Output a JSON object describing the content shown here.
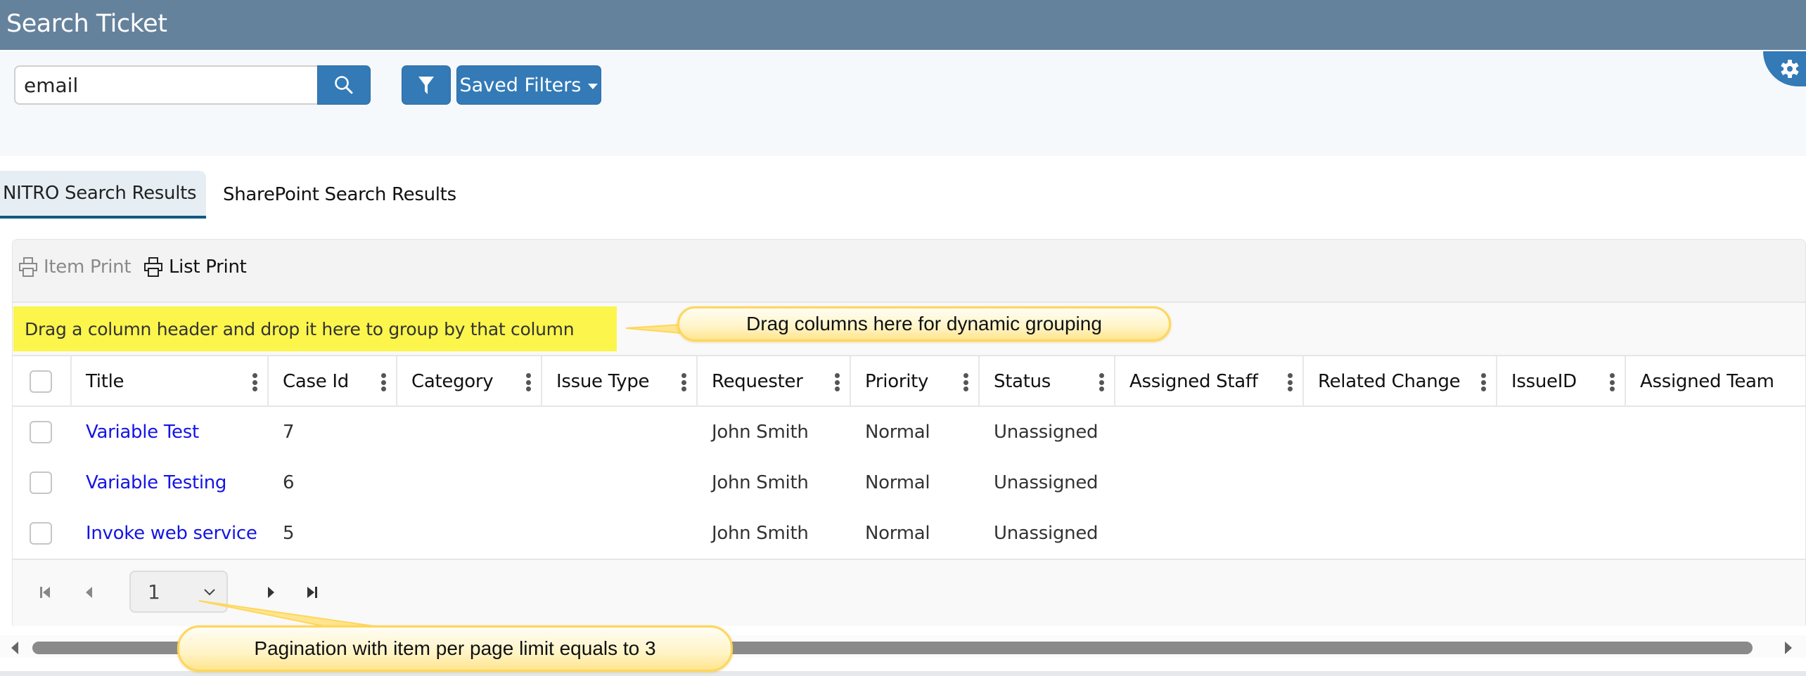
{
  "header": {
    "title": "Search Ticket"
  },
  "search": {
    "value": "email",
    "placeholder": ""
  },
  "toolbar": {
    "saved_filters_label": "Saved Filters"
  },
  "icons": {
    "search": "search-icon",
    "filter": "filter-icon",
    "settings": "gear-icon",
    "print": "printer-icon"
  },
  "tabs": [
    {
      "label": "NITRO Search Results",
      "active": true
    },
    {
      "label": "SharePoint Search Results",
      "active": false
    }
  ],
  "grid": {
    "toolbar": {
      "item_print": "Item Print",
      "list_print": "List Print"
    },
    "group_zone_text": "Drag a column header and drop it here to group by that column",
    "columns": [
      "Title",
      "Case Id",
      "Category",
      "Issue Type",
      "Requester",
      "Priority",
      "Status",
      "Assigned Staff",
      "Related Change",
      "IssueID",
      "Assigned Team"
    ],
    "rows": [
      {
        "title": "Variable Test",
        "case_id": "7",
        "category": "",
        "issue_type": "",
        "requester": "John Smith",
        "priority": "Normal",
        "status": "Unassigned"
      },
      {
        "title": "Variable Testing",
        "case_id": "6",
        "category": "",
        "issue_type": "",
        "requester": "John Smith",
        "priority": "Normal",
        "status": "Unassigned"
      },
      {
        "title": "Invoke web service",
        "case_id": "5",
        "category": "",
        "issue_type": "",
        "requester": "John Smith",
        "priority": "Normal",
        "status": "Unassigned"
      }
    ],
    "pager": {
      "current_page": "1"
    }
  },
  "annotations": {
    "grouping": "Drag columns here for dynamic grouping",
    "pagination": "Pagination with item per page limit equals to 3"
  },
  "colors": {
    "header_bg": "#65829c",
    "primary_button": "#337ab7",
    "link": "#1414e6",
    "group_zone_highlight": "#fbf54c",
    "active_tab_border": "#0f5a80"
  }
}
